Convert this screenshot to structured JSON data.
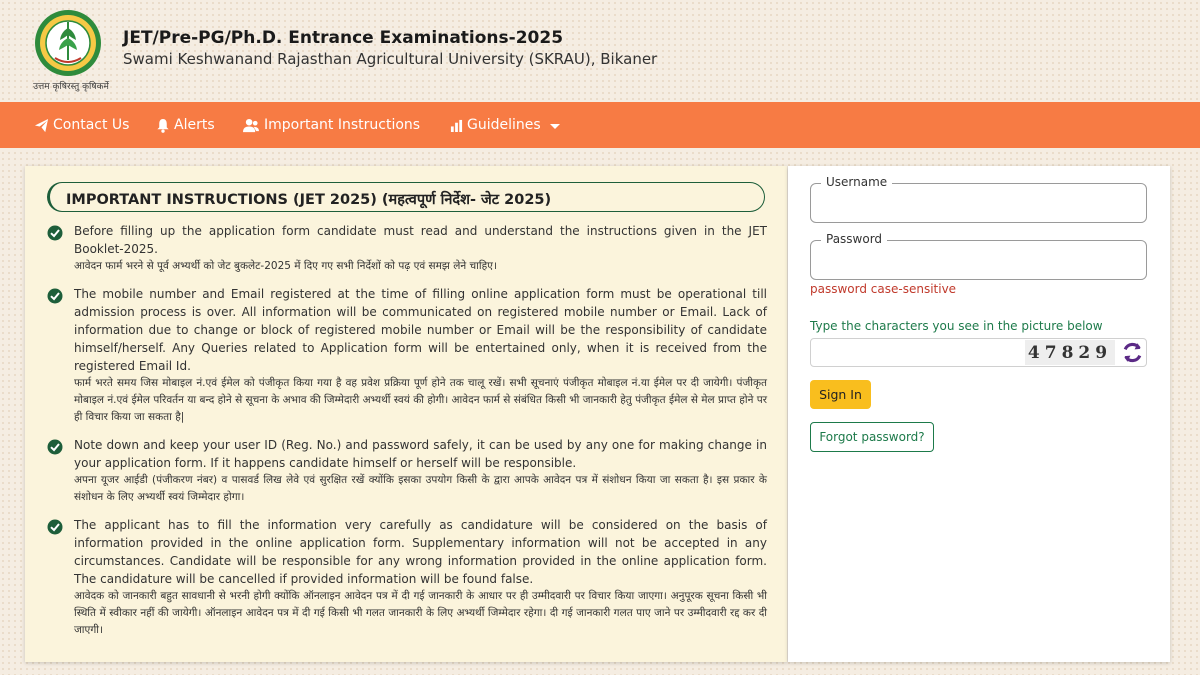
{
  "header": {
    "title": "JET/Pre-PG/Ph.D. Entrance Examinations-2025",
    "subtitle": "Swami Keshwanand Rajasthan Agricultural University (SKRAU), Bikaner",
    "logo_motto": "उत्तम कृषिरस्तु कृषिकर्मे"
  },
  "nav": {
    "items": [
      {
        "label": "Contact Us",
        "icon": "paper-plane-icon"
      },
      {
        "label": "Alerts",
        "icon": "bell-icon"
      },
      {
        "label": "Important Instructions",
        "icon": "users-icon"
      },
      {
        "label": "Guidelines",
        "icon": "bar-chart-icon"
      }
    ]
  },
  "instructions": {
    "heading": "IMPORTANT INSTRUCTIONS (JET 2025) (महत्वपूर्ण निर्देश- जेट 2025)",
    "items": [
      {
        "en": "Before filling up the application form candidate must read and understand the instructions given in the JET Booklet-2025.",
        "hi": "आवेदन फार्म भरने से पूर्व अभ्यर्थी को जेट बुकलेट-2025 में दिए गए सभी निर्देशों को पढ़ एवं समझ लेने चाहिए।"
      },
      {
        "en": "The mobile number and Email registered at the time of filling online application form must be operational till admission process is over. All information will be communicated on registered mobile number or Email. Lack of information due to change or block of registered mobile number or Email will be the responsibility of candidate himself/herself. Any Queries related to Application form will be entertained only, when it is received from the registered Email Id.",
        "hi": "फार्म भरते समय जिस मोबाइल नं.एवं ईमेल को पंजीकृत किया गया है वह प्रवेश प्रक्रिया पूर्ण होने तक चालू रखें। सभी सूचनाएं पंजीकृत मोबाइल नं.या ईमेल पर दी जायेगी। पंजीकृत मोबाइल नं.एवं ईमेल परिवर्तन या बन्द होने से सूचना के अभाव की जिम्मेदारी अभ्यर्थी स्वयं की होगी। आवेदन फार्म से संबंधित किसी भी जानकारी हेतु पंजीकृत ईमेल से मेल प्राप्त होने पर ही विचार किया जा सकता है|"
      },
      {
        "en": "Note down and keep your user ID (Reg. No.) and password safely, it can be used by any one for making change in your application form. If it happens candidate himself or herself will be responsible.",
        "hi": "अपना यूजर आईडी (पंजीकरण नंबर) व पासवर्ड लिख लेवे एवं सुरक्षित रखें क्योंकि इसका उपयोग किसी के द्वारा आपके आवेदन पत्र में संशोधन किया जा सकता है। इस प्रकार के संशोधन के लिए अभ्यर्थी स्वयं जिम्मेदार होगा।"
      },
      {
        "en": "The applicant has to fill the information very carefully as candidature will be considered on the basis of information provided in the online application form. Supplementary information will not be accepted in any circumstances. Candidate will be responsible for any wrong information provided in the online application form. The candidature will be cancelled if provided information will be found false.",
        "hi": "आवेदक को जानकारी बहुत सावधानी से भरनी होगी क्योंकि ऑनलाइन आवेदन पत्र में दी गई जानकारी के आधार पर ही उम्मीदवारी पर विचार किया जाएगा। अनुपूरक सूचना किसी भी स्थिति में स्वीकार नहीं की जायेगी। ऑनलाइन आवेदन पत्र में दी गई किसी भी गलत जानकारी के लिए अभ्यर्थी जिम्मेदार रहेगा। दी गई जानकारी गलत पाए जाने पर उम्मीदवारी रद्द कर दी जाएगी।"
      }
    ]
  },
  "login": {
    "username_label": "Username",
    "username_value": "",
    "password_label": "Password",
    "password_value": "",
    "password_note": "password case-sensitive",
    "captcha_label": "Type the characters you see in the picture below",
    "captcha_value": "",
    "captcha_text": "47829",
    "signin_label": "Sign In",
    "forgot_label": "Forgot password?"
  },
  "colors": {
    "nav_bg": "#f77b44",
    "accent_green": "#1d7a4a",
    "signin_bg": "#f9be1e",
    "note_red": "#c0392b",
    "panel_cream": "#fbf4dc"
  }
}
